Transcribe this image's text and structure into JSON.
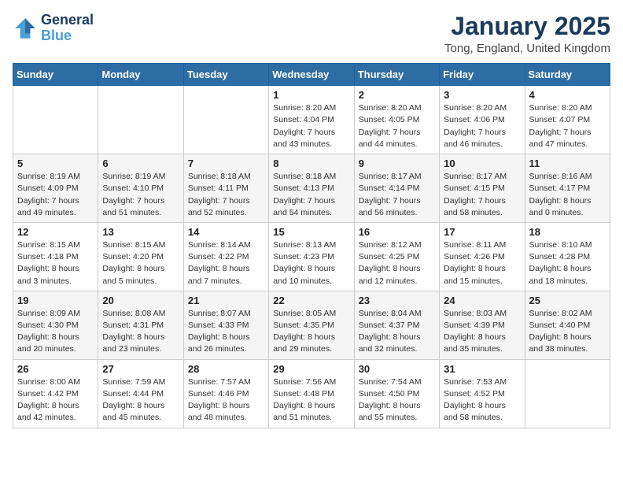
{
  "header": {
    "logo_line1": "General",
    "logo_line2": "Blue",
    "title": "January 2025",
    "subtitle": "Tong, England, United Kingdom"
  },
  "days_of_week": [
    "Sunday",
    "Monday",
    "Tuesday",
    "Wednesday",
    "Thursday",
    "Friday",
    "Saturday"
  ],
  "weeks": [
    [
      null,
      null,
      null,
      {
        "day": 1,
        "sunrise": "8:20 AM",
        "sunset": "4:04 PM",
        "daylight": "7 hours and 43 minutes."
      },
      {
        "day": 2,
        "sunrise": "8:20 AM",
        "sunset": "4:05 PM",
        "daylight": "7 hours and 44 minutes."
      },
      {
        "day": 3,
        "sunrise": "8:20 AM",
        "sunset": "4:06 PM",
        "daylight": "7 hours and 46 minutes."
      },
      {
        "day": 4,
        "sunrise": "8:20 AM",
        "sunset": "4:07 PM",
        "daylight": "7 hours and 47 minutes."
      }
    ],
    [
      {
        "day": 5,
        "sunrise": "8:19 AM",
        "sunset": "4:09 PM",
        "daylight": "7 hours and 49 minutes."
      },
      {
        "day": 6,
        "sunrise": "8:19 AM",
        "sunset": "4:10 PM",
        "daylight": "7 hours and 51 minutes."
      },
      {
        "day": 7,
        "sunrise": "8:18 AM",
        "sunset": "4:11 PM",
        "daylight": "7 hours and 52 minutes."
      },
      {
        "day": 8,
        "sunrise": "8:18 AM",
        "sunset": "4:13 PM",
        "daylight": "7 hours and 54 minutes."
      },
      {
        "day": 9,
        "sunrise": "8:17 AM",
        "sunset": "4:14 PM",
        "daylight": "7 hours and 56 minutes."
      },
      {
        "day": 10,
        "sunrise": "8:17 AM",
        "sunset": "4:15 PM",
        "daylight": "7 hours and 58 minutes."
      },
      {
        "day": 11,
        "sunrise": "8:16 AM",
        "sunset": "4:17 PM",
        "daylight": "8 hours and 0 minutes."
      }
    ],
    [
      {
        "day": 12,
        "sunrise": "8:15 AM",
        "sunset": "4:18 PM",
        "daylight": "8 hours and 3 minutes."
      },
      {
        "day": 13,
        "sunrise": "8:15 AM",
        "sunset": "4:20 PM",
        "daylight": "8 hours and 5 minutes."
      },
      {
        "day": 14,
        "sunrise": "8:14 AM",
        "sunset": "4:22 PM",
        "daylight": "8 hours and 7 minutes."
      },
      {
        "day": 15,
        "sunrise": "8:13 AM",
        "sunset": "4:23 PM",
        "daylight": "8 hours and 10 minutes."
      },
      {
        "day": 16,
        "sunrise": "8:12 AM",
        "sunset": "4:25 PM",
        "daylight": "8 hours and 12 minutes."
      },
      {
        "day": 17,
        "sunrise": "8:11 AM",
        "sunset": "4:26 PM",
        "daylight": "8 hours and 15 minutes."
      },
      {
        "day": 18,
        "sunrise": "8:10 AM",
        "sunset": "4:28 PM",
        "daylight": "8 hours and 18 minutes."
      }
    ],
    [
      {
        "day": 19,
        "sunrise": "8:09 AM",
        "sunset": "4:30 PM",
        "daylight": "8 hours and 20 minutes."
      },
      {
        "day": 20,
        "sunrise": "8:08 AM",
        "sunset": "4:31 PM",
        "daylight": "8 hours and 23 minutes."
      },
      {
        "day": 21,
        "sunrise": "8:07 AM",
        "sunset": "4:33 PM",
        "daylight": "8 hours and 26 minutes."
      },
      {
        "day": 22,
        "sunrise": "8:05 AM",
        "sunset": "4:35 PM",
        "daylight": "8 hours and 29 minutes."
      },
      {
        "day": 23,
        "sunrise": "8:04 AM",
        "sunset": "4:37 PM",
        "daylight": "8 hours and 32 minutes."
      },
      {
        "day": 24,
        "sunrise": "8:03 AM",
        "sunset": "4:39 PM",
        "daylight": "8 hours and 35 minutes."
      },
      {
        "day": 25,
        "sunrise": "8:02 AM",
        "sunset": "4:40 PM",
        "daylight": "8 hours and 38 minutes."
      }
    ],
    [
      {
        "day": 26,
        "sunrise": "8:00 AM",
        "sunset": "4:42 PM",
        "daylight": "8 hours and 42 minutes."
      },
      {
        "day": 27,
        "sunrise": "7:59 AM",
        "sunset": "4:44 PM",
        "daylight": "8 hours and 45 minutes."
      },
      {
        "day": 28,
        "sunrise": "7:57 AM",
        "sunset": "4:46 PM",
        "daylight": "8 hours and 48 minutes."
      },
      {
        "day": 29,
        "sunrise": "7:56 AM",
        "sunset": "4:48 PM",
        "daylight": "8 hours and 51 minutes."
      },
      {
        "day": 30,
        "sunrise": "7:54 AM",
        "sunset": "4:50 PM",
        "daylight": "8 hours and 55 minutes."
      },
      {
        "day": 31,
        "sunrise": "7:53 AM",
        "sunset": "4:52 PM",
        "daylight": "8 hours and 58 minutes."
      },
      null
    ]
  ]
}
